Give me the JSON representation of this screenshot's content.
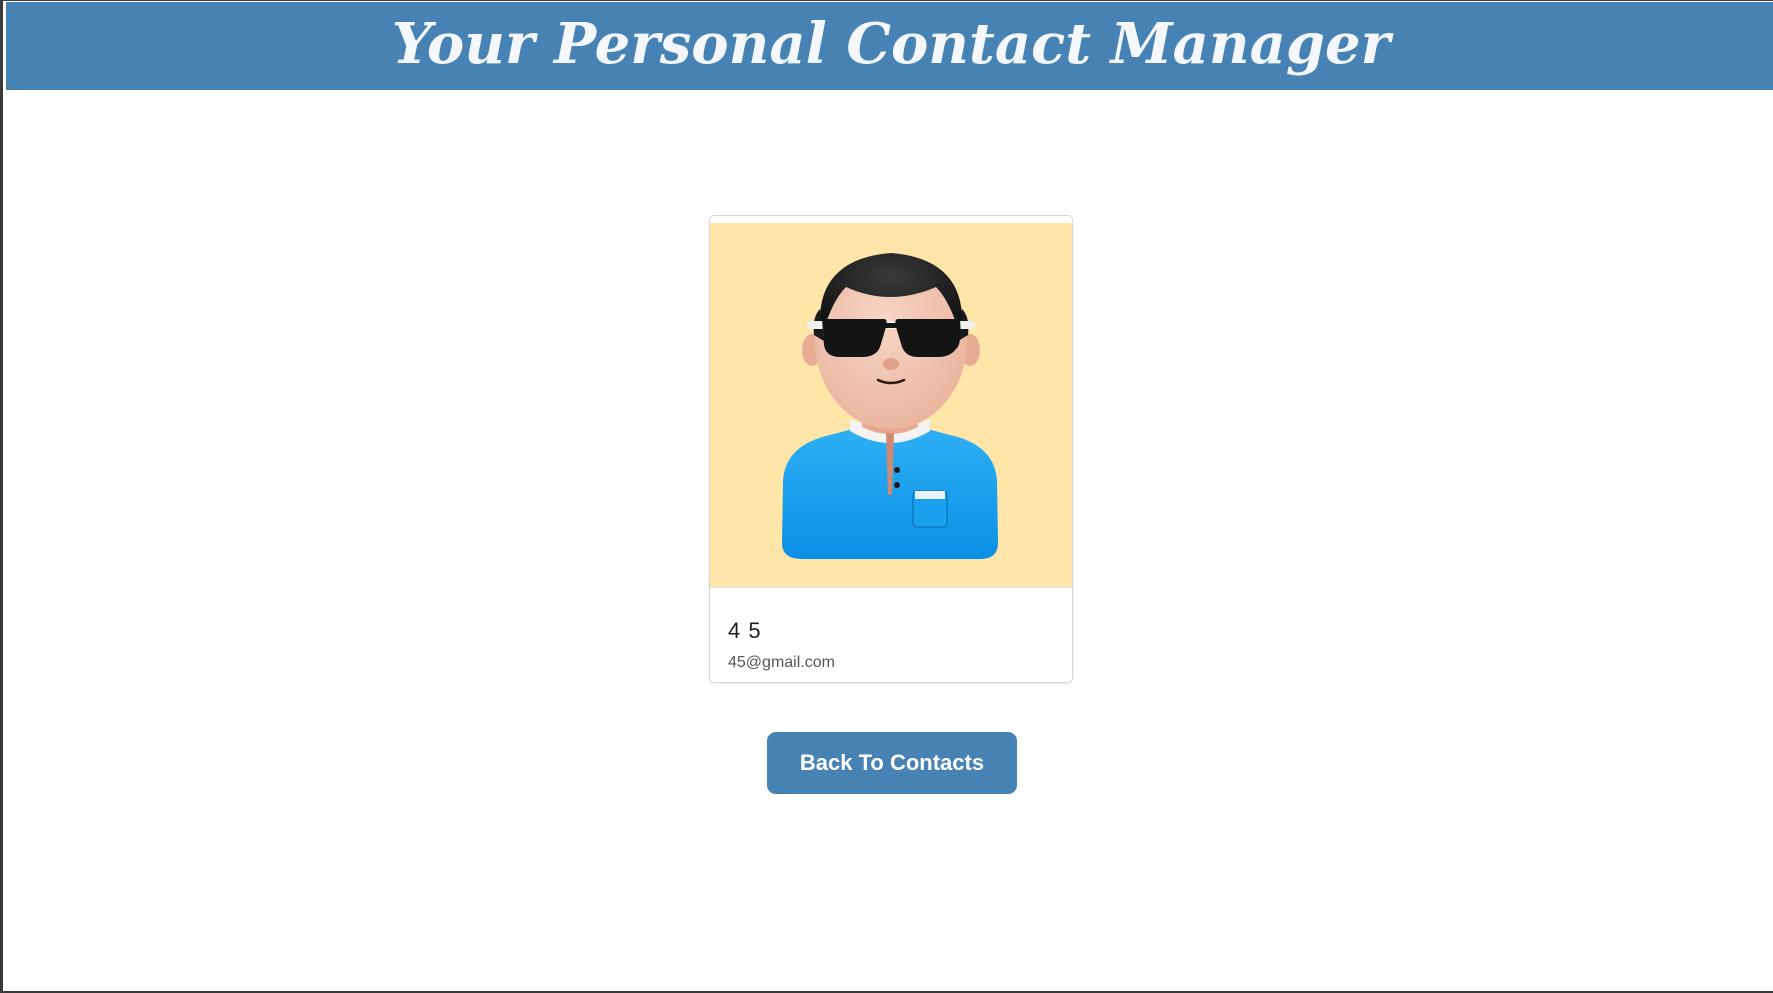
{
  "header": {
    "title": "Your Personal Contact Manager"
  },
  "contact": {
    "name": "4 5",
    "email": "45@gmail.com",
    "avatar_icon": "avatar-sunglasses-icon"
  },
  "actions": {
    "back_label": "Back To Contacts"
  },
  "colors": {
    "accent": "#4682b4",
    "avatar_background": "#ffe6a8"
  }
}
